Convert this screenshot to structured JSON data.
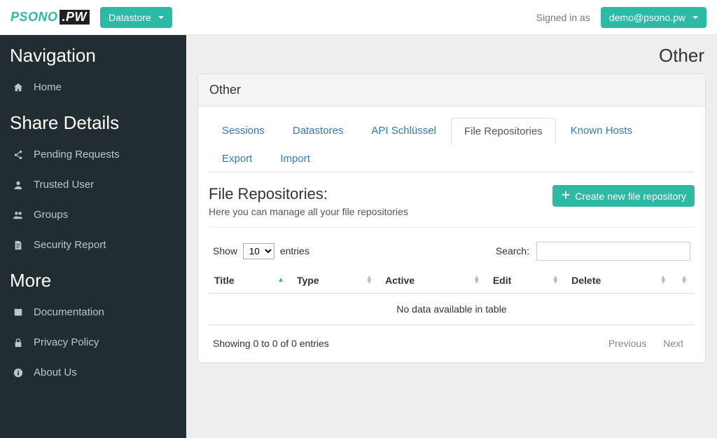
{
  "app": {
    "brand1": "PSONO",
    "brand2": ".PW"
  },
  "topbar": {
    "datastore_label": "Datastore",
    "signed_in_label": "Signed in as",
    "user_email": "demo@psono.pw"
  },
  "sidebar": {
    "headers": {
      "nav": "Navigation",
      "share": "Share Details",
      "more": "More"
    },
    "home": "Home",
    "pending": "Pending Requests",
    "trusted": "Trusted User",
    "groups": "Groups",
    "security": "Security Report",
    "docs": "Documentation",
    "privacy": "Privacy Policy",
    "about": "About Us"
  },
  "page": {
    "title": "Other",
    "panel_title": "Other"
  },
  "tabs": {
    "sessions": "Sessions",
    "datastores": "Datastores",
    "api": "API Schlüssel",
    "file_repos": "File Repositories",
    "known_hosts": "Known Hosts",
    "export": "Export",
    "import": "Import"
  },
  "section": {
    "heading": "File Repositories:",
    "sub": "Here you can manage all your file repositories",
    "create_btn": "Create new file repository"
  },
  "table": {
    "show": "Show",
    "entries": "entries",
    "length_value": "10",
    "search_label": "Search:",
    "search_value": "",
    "cols": {
      "title": "Title",
      "type": "Type",
      "active": "Active",
      "edit": "Edit",
      "delete": "Delete"
    },
    "empty": "No data available in table",
    "info": "Showing 0 to 0 of 0 entries",
    "prev": "Previous",
    "next": "Next"
  }
}
